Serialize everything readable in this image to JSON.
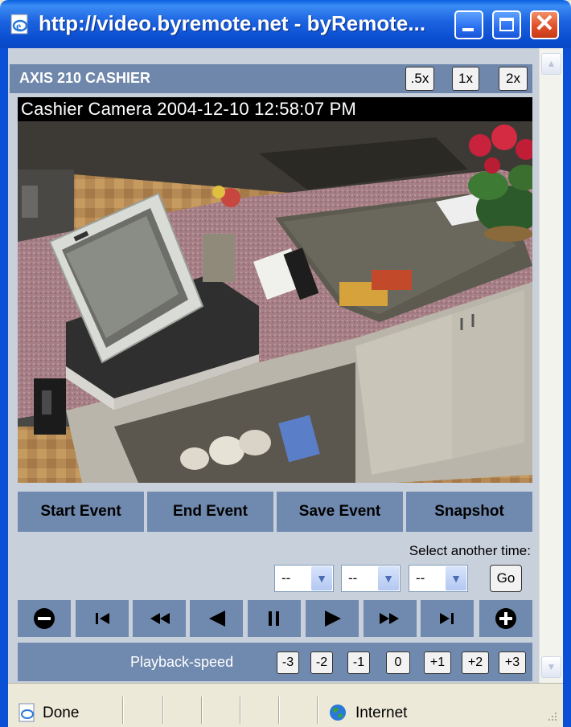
{
  "window": {
    "title": "http://video.byremote.net - byRemote...",
    "min_glyph": "",
    "max_glyph": "",
    "close_glyph": "✕"
  },
  "camera": {
    "title": "AXIS 210 CASHIER",
    "zoom": [
      ".5x",
      "1x",
      "2x"
    ],
    "caption": "Cashier Camera 2004-12-10 12:58:07 PM"
  },
  "events": [
    "Start Event",
    "End Event",
    "Save Event",
    "Snapshot"
  ],
  "time_select": {
    "label": "Select another time:",
    "dropdowns": [
      "--",
      "--",
      "--"
    ],
    "go_label": "Go"
  },
  "playback": {
    "controls": [
      "zoom-out-icon",
      "skip-to-start-icon",
      "rewind-icon",
      "step-back-icon",
      "pause-icon",
      "play-icon",
      "fast-forward-icon",
      "skip-to-end-icon",
      "zoom-in-icon"
    ],
    "speed_label": "Playback-speed",
    "speeds": [
      "-3",
      "-2",
      "-1",
      "0",
      "+1",
      "+2",
      "+3"
    ]
  },
  "status": {
    "text": "Done",
    "zone": "Internet"
  },
  "colors": {
    "header_bg": "#6f87ab",
    "button_bg": "#7089ae",
    "title_bar": "#0a50d6"
  }
}
